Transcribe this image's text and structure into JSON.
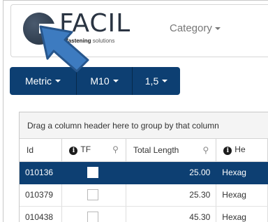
{
  "logo": {
    "brand": "FACIL",
    "tag_bold": "fastening",
    "tag_rest": " solutions"
  },
  "nav": {
    "category_label": "Category"
  },
  "filters": [
    {
      "label": "Metric"
    },
    {
      "label": "M10"
    },
    {
      "label": "1,5"
    }
  ],
  "grid": {
    "group_hint": "Drag a column header here to group by that column",
    "columns": [
      "Id",
      "TF",
      "Total Length",
      "He"
    ],
    "rows": [
      {
        "id": "010136",
        "total_length": "25.00",
        "head": "Hexag",
        "selected": true
      },
      {
        "id": "010379",
        "total_length": "25.30",
        "head": "Hexag",
        "selected": false
      },
      {
        "id": "010438",
        "total_length": "45.30",
        "head": "Hexag",
        "selected": false
      }
    ]
  },
  "colors": {
    "primary": "#0d3f72",
    "arrow": "#3d7bc0"
  }
}
